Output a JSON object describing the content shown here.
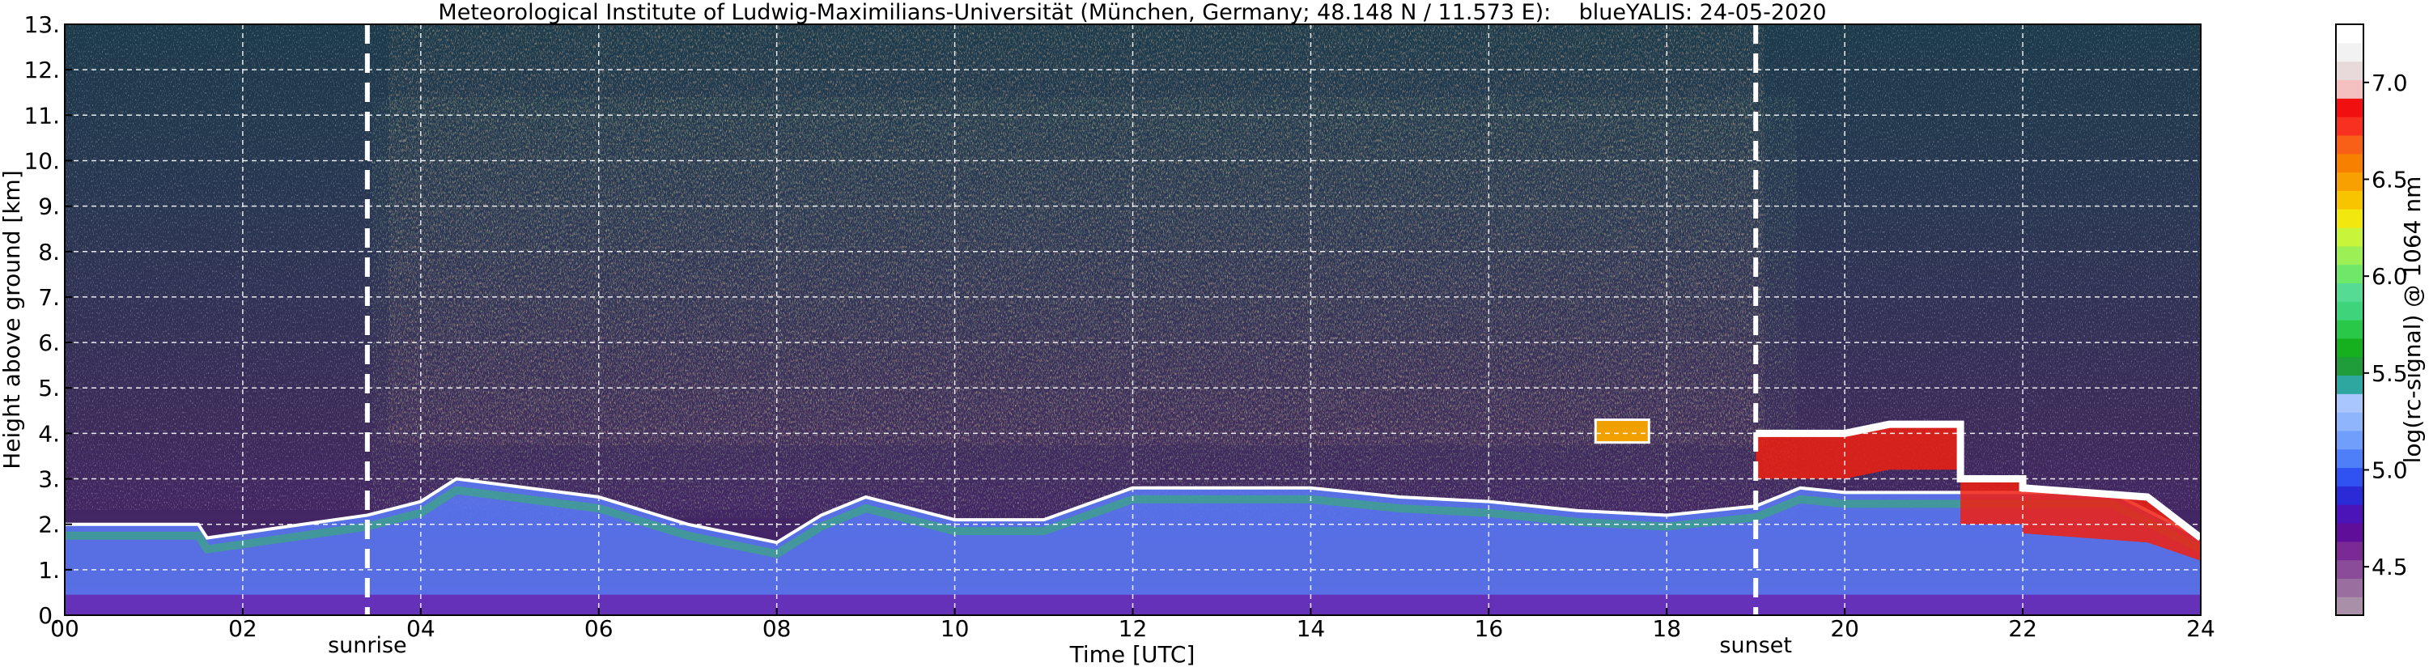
{
  "chart_data": {
    "type": "heatmap",
    "title": "Meteorological Institute of Ludwig-Maximilians-Universität (München, Germany; 48.148 N / 11.573 E):    blueYALIS: 24-05-2020",
    "xlabel": "Time [UTC]",
    "ylabel": "Height above ground [km]",
    "colorbar_label": "log(rc-signal) @ 1064 nm",
    "xlim": [
      0,
      24
    ],
    "ylim": [
      0,
      13
    ],
    "x_ticks": [
      0,
      2,
      4,
      6,
      8,
      10,
      12,
      14,
      16,
      18,
      20,
      22,
      24
    ],
    "x_tick_labels": [
      "00",
      "02",
      "04",
      "06",
      "08",
      "10",
      "12",
      "14",
      "16",
      "18",
      "20",
      "22",
      "24"
    ],
    "y_ticks": [
      0,
      1,
      2,
      3,
      4,
      5,
      6,
      7,
      8,
      9,
      10,
      11,
      12,
      13
    ],
    "y_tick_labels": [
      "0.",
      "1.",
      "2.",
      "3.",
      "4.",
      "5.",
      "6.",
      "7.",
      "8.",
      "9.",
      "10.",
      "11.",
      "12.",
      "13."
    ],
    "colorbar_range": [
      4.25,
      7.3
    ],
    "colorbar_ticks": [
      4.5,
      5.0,
      5.5,
      6.0,
      6.5,
      7.0
    ],
    "colorbar_tick_labels": [
      "4.5",
      "5.0",
      "5.5",
      "6.0",
      "6.5",
      "7.0"
    ],
    "colorbar_colors": [
      "#a98fa8",
      "#9a6fa0",
      "#8a4c98",
      "#7a2a94",
      "#5f0e9a",
      "#4a14b8",
      "#2a2ad6",
      "#2f52f0",
      "#4e7ef8",
      "#6f9ffb",
      "#8fb6fc",
      "#a9c7fc",
      "#2ea7a0",
      "#1e9d3a",
      "#16b01e",
      "#2ac848",
      "#3ed47c",
      "#56dc92",
      "#6fe86a",
      "#9cf056",
      "#c8f43a",
      "#f2e810",
      "#f8c400",
      "#f8a000",
      "#f88000",
      "#f86018",
      "#f83020",
      "#f01010",
      "#f4c0c0",
      "#e8dada",
      "#f2f2f2",
      "#ffffff"
    ],
    "grid": true,
    "grid_style": "dashed",
    "annotations": [
      {
        "label": "sunrise",
        "x": 3.4
      },
      {
        "label": "sunset",
        "x": 19.0
      }
    ],
    "features": [
      {
        "kind": "boundary-layer-top",
        "x": [
          0,
          1.5,
          1.6,
          3.4,
          4.0,
          4.4,
          6.0,
          7.0,
          8.0,
          8.5,
          9.0,
          10.0,
          11.0,
          12.0,
          13.0,
          14.0,
          15.0,
          16.0,
          17.0,
          18.0,
          19.0,
          19.5,
          20.0,
          21.0,
          22.0,
          23.0,
          24.0
        ],
        "y": [
          2.0,
          2.0,
          1.7,
          2.2,
          2.5,
          3.0,
          2.6,
          2.0,
          1.6,
          2.2,
          2.6,
          2.1,
          2.1,
          2.8,
          2.8,
          2.8,
          2.6,
          2.5,
          2.3,
          2.2,
          2.4,
          2.8,
          2.7,
          2.7,
          2.7,
          2.7,
          1.7
        ]
      },
      {
        "kind": "cloud-layer",
        "x": [
          19.0,
          20.0,
          20.5,
          21.3,
          21.3,
          22.0,
          22.0,
          23.4,
          24.0
        ],
        "y": [
          4.0,
          4.0,
          4.2,
          4.2,
          3.0,
          3.0,
          2.8,
          2.6,
          1.7
        ]
      },
      {
        "kind": "cloud-patch",
        "x": [
          17.2,
          17.8
        ],
        "y": [
          3.8,
          4.3
        ]
      }
    ]
  }
}
